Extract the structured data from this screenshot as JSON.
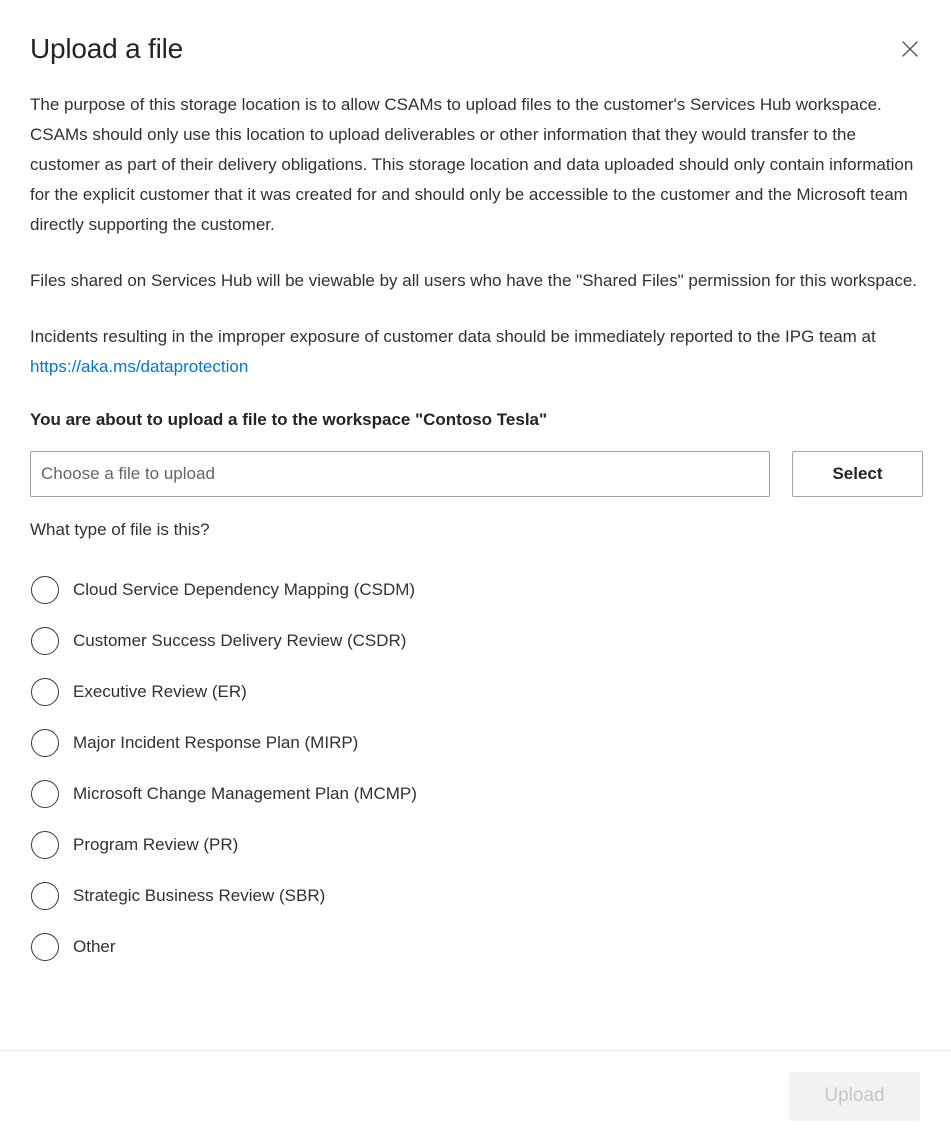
{
  "dialog": {
    "title": "Upload a file",
    "close_icon": "close-icon",
    "paragraphs": [
      "The purpose of this storage location is to allow CSAMs to upload files to the customer's Services Hub workspace. CSAMs should only use this location to upload deliverables or other information that they would transfer to the customer as part of their delivery obligations. This storage location and data uploaded should only contain information for the explicit customer that it was created for and should only be accessible to the customer and the Microsoft team directly supporting the customer.",
      "Files shared on Services Hub will be viewable by all users who have the \"Shared Files\" permission for this workspace."
    ],
    "incident_paragraph": {
      "text_before_link": "Incidents resulting in the improper exposure of customer data should be immediately reported to the IPG team at ",
      "link_text": "https://aka.ms/dataprotection"
    },
    "workspace_line": "You are about to upload a file to the workspace \"Contoso Tesla\"",
    "file_picker": {
      "input_placeholder": "Choose a file to upload",
      "input_value": "",
      "select_label": "Select"
    },
    "file_type_question": "What type of file is this?",
    "file_type_options": [
      {
        "label": "Cloud Service Dependency Mapping (CSDM)",
        "selected": false
      },
      {
        "label": "Customer Success Delivery Review (CSDR)",
        "selected": false
      },
      {
        "label": "Executive Review (ER)",
        "selected": false
      },
      {
        "label": "Major Incident Response Plan (MIRP)",
        "selected": false
      },
      {
        "label": "Microsoft Change Management Plan (MCMP)",
        "selected": false
      },
      {
        "label": "Program Review (PR)",
        "selected": false
      },
      {
        "label": "Strategic Business Review (SBR)",
        "selected": false
      },
      {
        "label": "Other",
        "selected": false
      }
    ],
    "footer": {
      "upload_label": "Upload",
      "upload_disabled": true
    },
    "colors": {
      "link": "#0078d4",
      "text": "#323130",
      "title": "#242424",
      "disabled_button_bg": "#f3f2f1",
      "disabled_button_text": "#c8c6c4",
      "border": "#a19f9d",
      "divider": "#edebe9"
    }
  }
}
